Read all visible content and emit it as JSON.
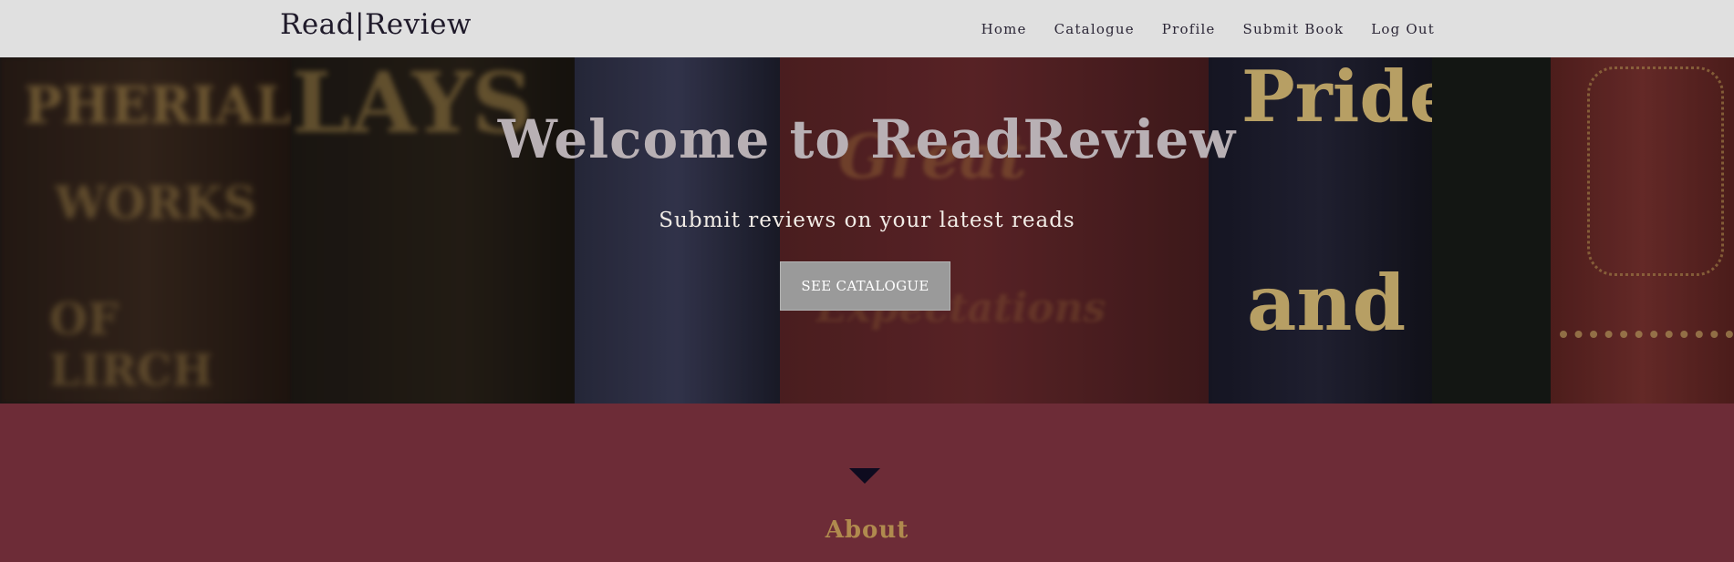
{
  "nav": {
    "brand": "Read|Review",
    "links": [
      "Home",
      "Catalogue",
      "Profile",
      "Submit Book",
      "Log Out"
    ]
  },
  "hero": {
    "title": "Welcome to ReadReview",
    "subtitle": "Submit reviews on your latest reads",
    "cta_label": "SEE CATALOGUE",
    "background_spine_text": [
      "PHERIAL",
      "LAYS",
      "WORKS",
      "OF LIRCH",
      "Great",
      "Expectations",
      "Pride",
      "and"
    ]
  },
  "about": {
    "heading": "About"
  },
  "colors": {
    "navbar_bg": "#e0e0e0",
    "section_bg": "#6d2c37",
    "cta_bg": "#9a9a9a",
    "about_heading": "#b08a4e",
    "arrow": "#0e0b1f"
  },
  "icons": {
    "scroll_arrow": "caret-down-icon"
  }
}
